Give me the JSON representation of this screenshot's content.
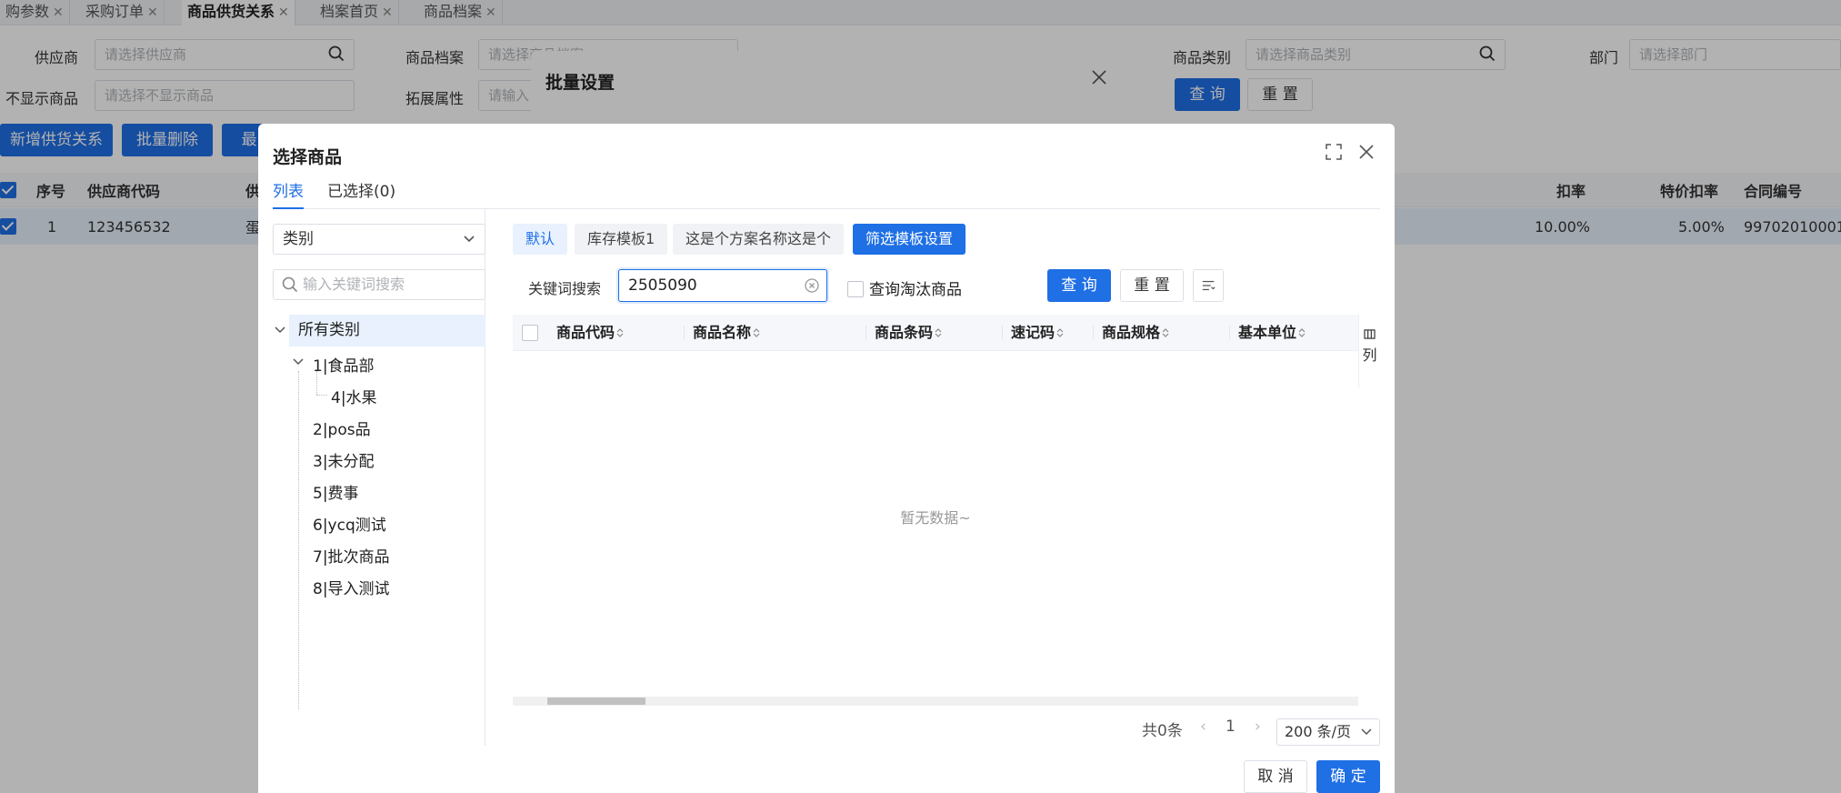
{
  "tabs": [
    {
      "label": "购参数",
      "active": false
    },
    {
      "label": "采购订单",
      "active": false
    },
    {
      "label": "商品供货关系",
      "active": true
    },
    {
      "label": "档案首页",
      "active": false
    },
    {
      "label": "商品档案",
      "active": false
    }
  ],
  "filters": {
    "supplier_label": "供应商",
    "supplier_placeholder": "请选择供应商",
    "product_label": "商品档案",
    "product_placeholder": "请选择商品档案",
    "category_label": "商品类别",
    "category_placeholder": "请选择商品类别",
    "dept_label": "部门",
    "dept_placeholder": "请选择部门",
    "hide_label": "不显示商品",
    "hide_placeholder": "请选择不显示商品",
    "ext_label": "拓展属性",
    "ext_placeholder": "请输入",
    "query_button": "查 询",
    "reset_button": "重 置"
  },
  "actions": {
    "add": "新增供货关系",
    "batch_delete": "批量删除",
    "more": "最"
  },
  "bg_table": {
    "headers": {
      "seq": "序号",
      "supplier_code": "供应商代码",
      "supplier": "供",
      "discount": "扣率",
      "special_discount": "特价扣率",
      "contract": "合同编号"
    },
    "row": {
      "seq": "1",
      "supplier_code": "123456532",
      "supplier": "蛋",
      "discount": "10.00%",
      "special_discount": "5.00%",
      "contract": "99702010001"
    }
  },
  "batch_dialog": {
    "title": "批量设置"
  },
  "dialog": {
    "title": "选择商品",
    "tabs": {
      "list": "列表",
      "selected": "已选择(0)"
    },
    "category_select": "类别",
    "keyword_placeholder": "输入关键词搜索",
    "tree": {
      "root": "所有类别",
      "nodes": [
        {
          "label": "1|食品部"
        },
        {
          "label": "4|水果"
        },
        {
          "label": "2|pos品"
        },
        {
          "label": "3|未分配"
        },
        {
          "label": "5|费事"
        },
        {
          "label": "6|ycq测试"
        },
        {
          "label": "7|批次商品"
        },
        {
          "label": "8|导入测试"
        }
      ]
    },
    "filter_tabs": [
      {
        "label": "默认"
      },
      {
        "label": "库存模板1"
      },
      {
        "label": "这是个方案名称这是个"
      },
      {
        "label": "筛选模板设置"
      }
    ],
    "keyword_label": "关键词搜索",
    "keyword_value": "2505090",
    "obsolete_label": "查询淘汰商品",
    "query_button": "查 询",
    "reset_button": "重 置",
    "columns": [
      "商品代码",
      "商品名称",
      "商品条码",
      "速记码",
      "商品规格",
      "基本单位"
    ],
    "column_settings": "列",
    "empty_text": "暂无数据~",
    "pager": {
      "total": "共0条",
      "page": "1",
      "page_size": "200 条/页"
    },
    "cancel_button": "取 消",
    "confirm_button": "确 定"
  },
  "colors": {
    "primary": "#1f6fe5",
    "selected_bg": "#e8f1fd"
  }
}
